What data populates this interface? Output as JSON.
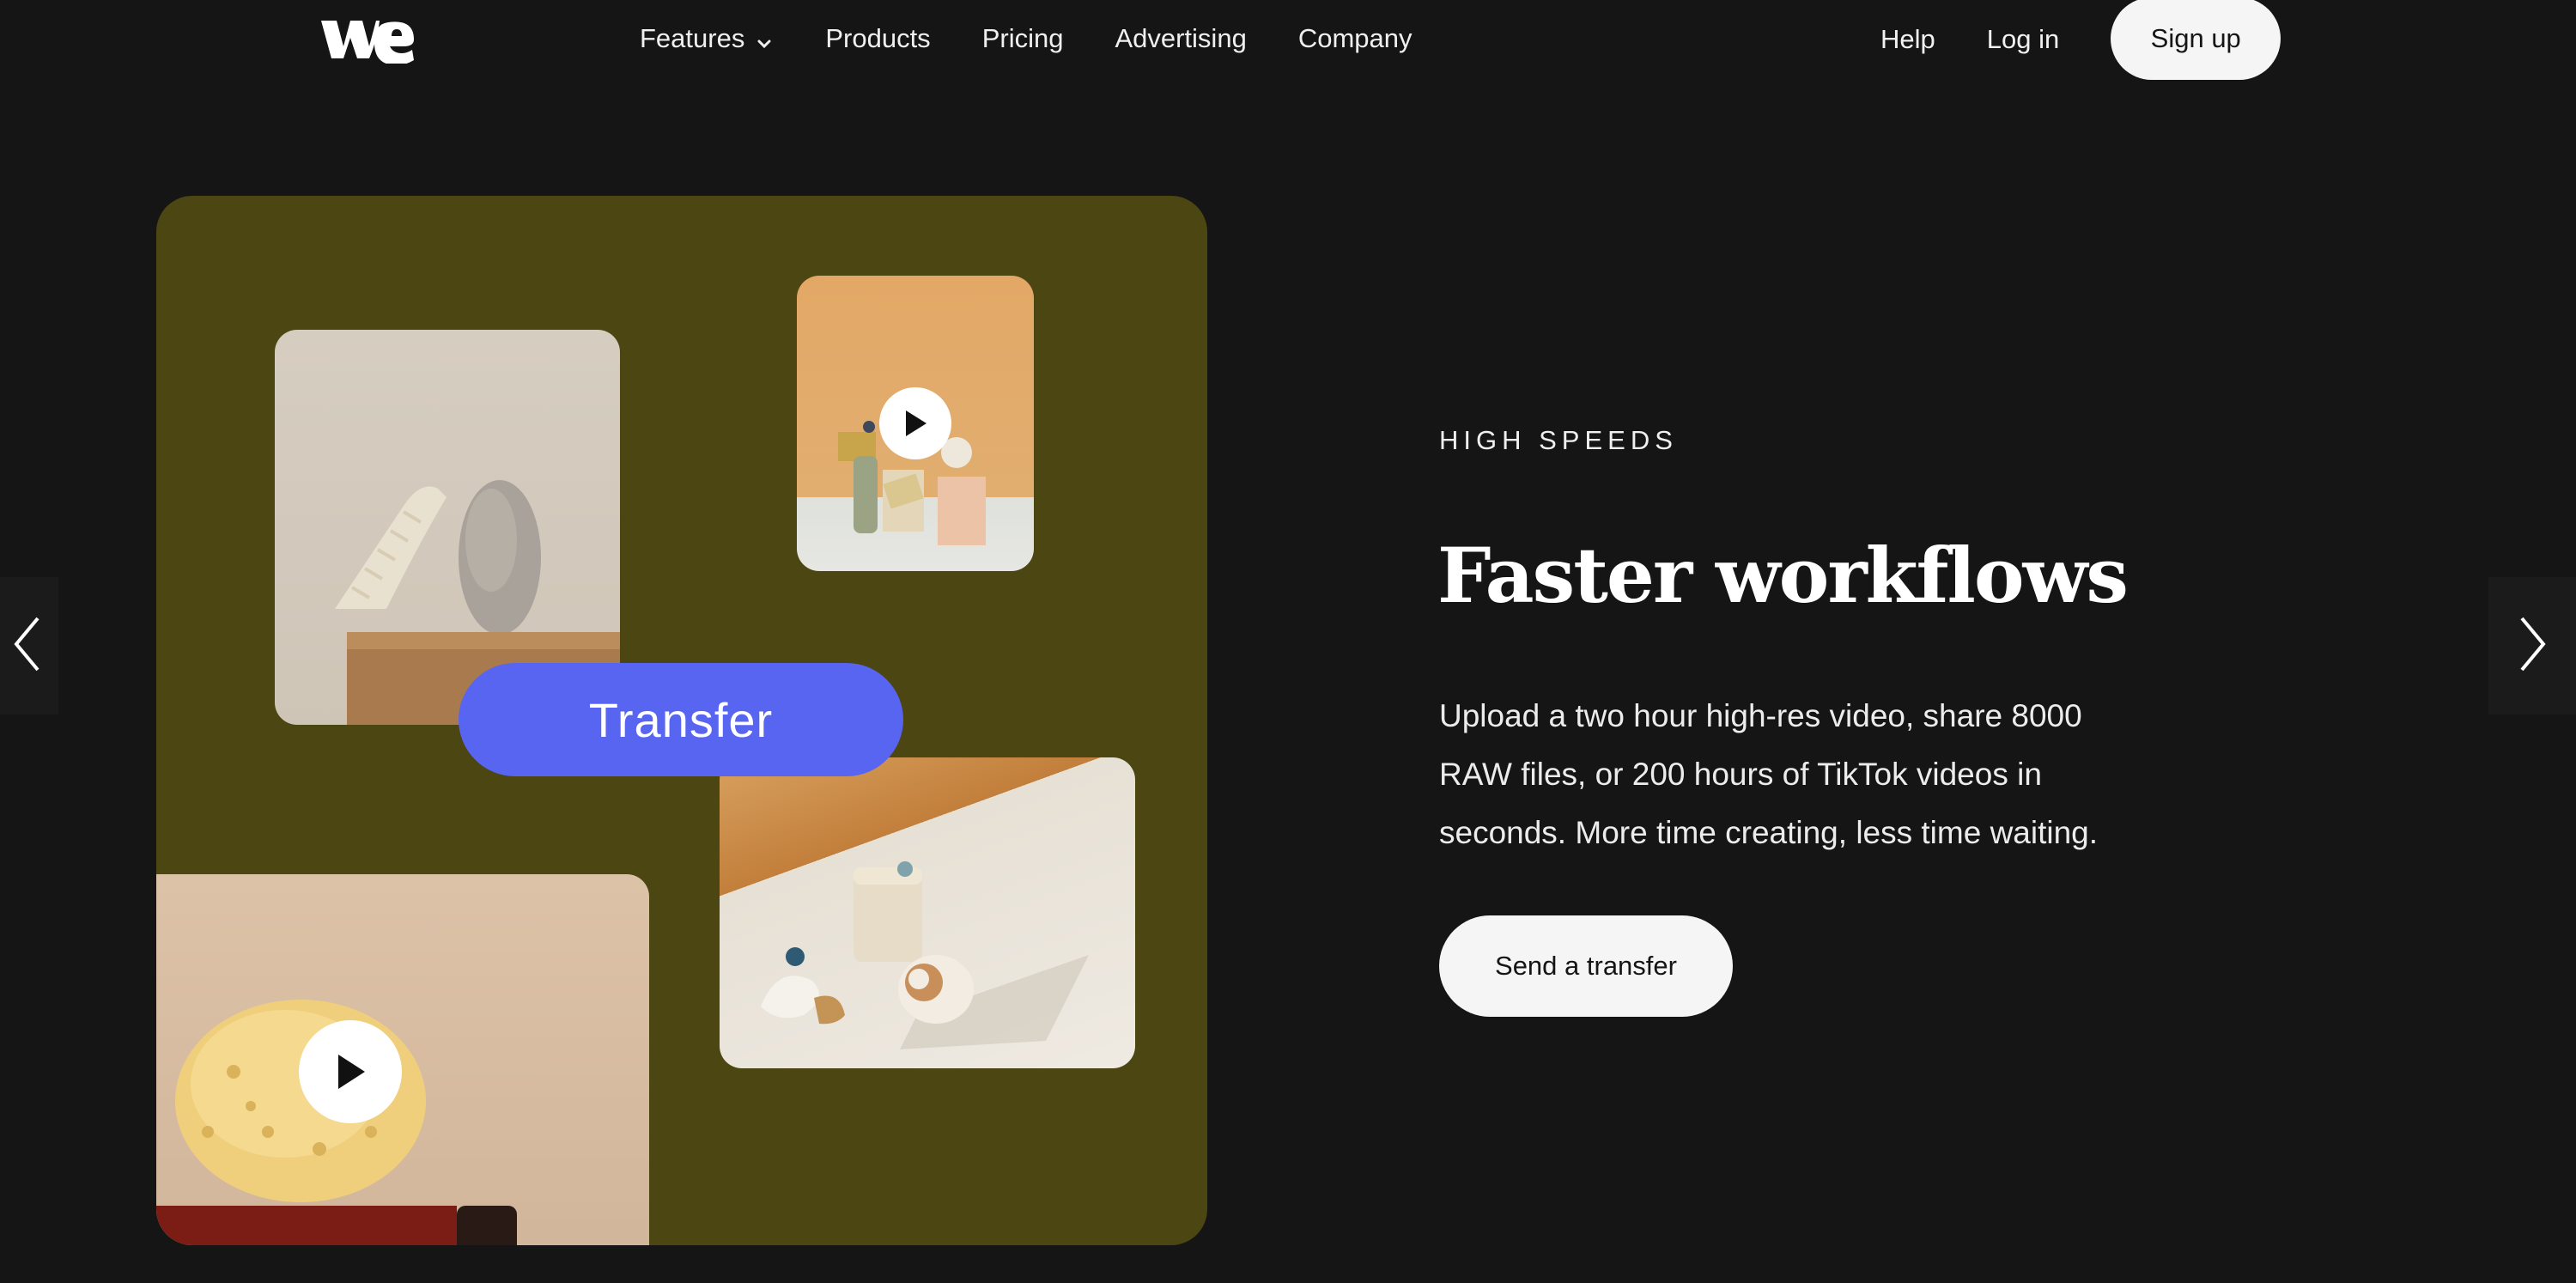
{
  "nav": {
    "logo_alt": "we",
    "links": [
      {
        "label": "Features",
        "has_dropdown": true
      },
      {
        "label": "Products"
      },
      {
        "label": "Pricing"
      },
      {
        "label": "Advertising"
      },
      {
        "label": "Company"
      }
    ],
    "help": "Help",
    "login": "Log in",
    "signup": "Sign up"
  },
  "hero_image": {
    "transfer_label": "Transfer",
    "icons": [
      "play-icon",
      "play-icon"
    ]
  },
  "hero": {
    "eyebrow": "HIGH SPEEDS",
    "title": "Faster workflows",
    "body": "Upload a two hour high-res video, share 8000 RAW files, or 200 hours of TikTok videos in seconds. More time creating, less time waiting.",
    "cta": "Send a transfer"
  },
  "colors": {
    "background": "#151515",
    "card": "#4c4612",
    "accent": "#5865f0",
    "button_bg": "#f5f5f5"
  }
}
